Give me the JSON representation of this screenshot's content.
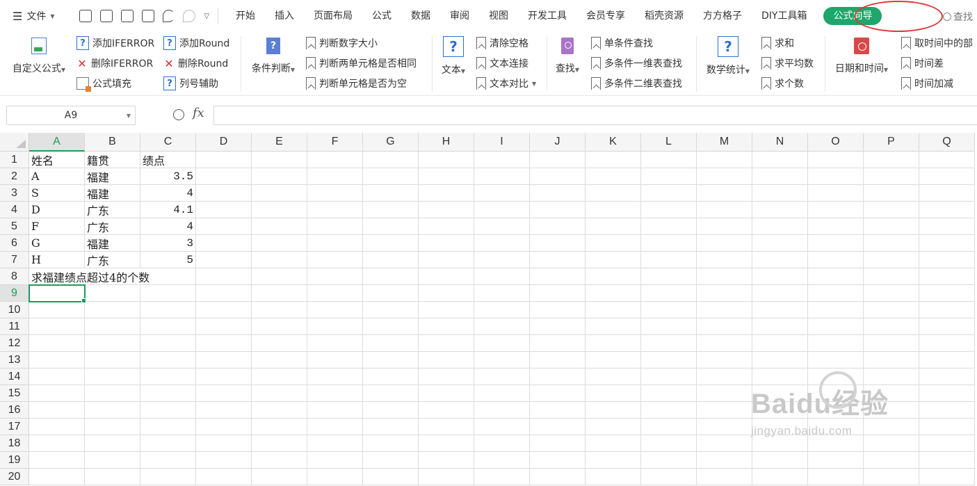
{
  "menu": {
    "file_label": "文件",
    "tabs": [
      "开始",
      "插入",
      "页面布局",
      "公式",
      "数据",
      "审阅",
      "视图",
      "开发工具",
      "会员专享",
      "稻壳资源",
      "方方格子",
      "DIY工具箱"
    ],
    "active_tab": "公式向导",
    "search_label": "查找",
    "accent_color": "#1fa66a",
    "highlight_ring_color": "#e0383a"
  },
  "ribbon": {
    "custom_formula": "自定义公式",
    "add_iferror": "添加IFERROR",
    "del_iferror": "删除IFERROR",
    "formula_fill": "公式填充",
    "add_round": "添加Round",
    "del_round": "删除Round",
    "col_helper": "列号辅助",
    "cond_judge": "条件判断",
    "judge_num_size": "判断数字大小",
    "judge_two_same": "判断两单元格是否相同",
    "judge_empty": "判断单元格是否为空",
    "text": "文本",
    "clear_space": "清除空格",
    "text_concat": "文本连接",
    "text_compare": "文本对比",
    "lookup": "查找",
    "single_lookup": "单条件查找",
    "multi_1d_lookup": "多条件一维表查找",
    "multi_2d_lookup": "多条件二维表查找",
    "math_stats": "数学统计",
    "sum": "求和",
    "average": "求平均数",
    "count": "求个数",
    "date_time": "日期和时间",
    "time_part": "取时间中的部",
    "time_diff": "时间差",
    "time_add": "时间加减"
  },
  "formula_bar": {
    "name_box": "A9",
    "fx": "fx",
    "formula": ""
  },
  "sheet": {
    "columns": [
      "A",
      "B",
      "C",
      "D",
      "E",
      "F",
      "G",
      "H",
      "I",
      "J",
      "K",
      "L",
      "M",
      "N",
      "O",
      "P",
      "Q"
    ],
    "rows": [
      "1",
      "2",
      "3",
      "4",
      "5",
      "6",
      "7",
      "8",
      "9",
      "10",
      "11",
      "12",
      "13",
      "14",
      "15",
      "16",
      "17",
      "18",
      "19",
      "20"
    ],
    "selected_cell": "A9",
    "data": [
      [
        "姓名",
        "籍贯",
        "绩点"
      ],
      [
        "A",
        "福建",
        "3.5"
      ],
      [
        "S",
        "福建",
        "4"
      ],
      [
        "D",
        "广东",
        "4.1"
      ],
      [
        "F",
        "广东",
        "4"
      ],
      [
        "G",
        "福建",
        "3"
      ],
      [
        "H",
        "广东",
        "5"
      ],
      [
        "求福建绩点超过4的个数",
        "",
        ""
      ]
    ]
  },
  "watermark": {
    "brand": "Baidu经验",
    "url": "jingyan.baidu.com"
  }
}
